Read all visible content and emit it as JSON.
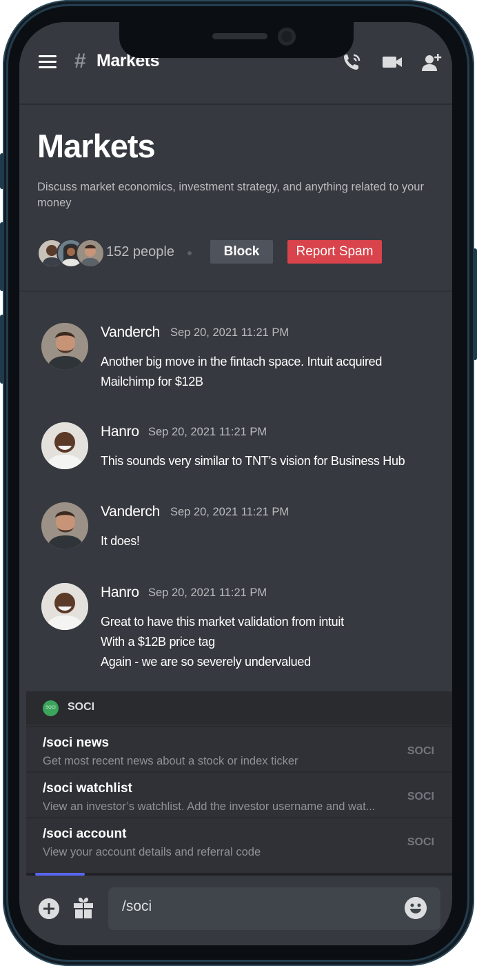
{
  "topbar": {
    "hash": "#",
    "title": "Markets"
  },
  "channel": {
    "title": "Markets",
    "description": "Discuss market economics, investment strategy, and anything related to your money",
    "people": "152 people",
    "block_label": "Block",
    "report_label": "Report Spam"
  },
  "messages": [
    {
      "author": "Vanderch",
      "time": "Sep 20, 2021 11:21 PM",
      "lines": [
        "Another big move in the fintach space. Intuit acquired",
        "Mailchimp for $12B"
      ]
    },
    {
      "author": "Hanro",
      "time": "Sep 20, 2021 11:21 PM",
      "lines": [
        "This sounds very similar to TNT’s vision for Business Hub"
      ]
    },
    {
      "author": "Vanderch",
      "time": "Sep 20, 2021 11:21 PM",
      "lines": [
        "It does!"
      ]
    },
    {
      "author": "Hanro",
      "time": "Sep 20, 2021 11:21 PM",
      "lines": [
        "Great to have this market validation from intuit",
        "With a $12B price tag",
        "Again - we are so severely undervalued"
      ]
    }
  ],
  "popup": {
    "logo_text": "SOCI",
    "title": "SOCI",
    "commands": [
      {
        "name": "/soci news",
        "desc": "Get most recent news about a stock or index ticker",
        "tag": "SOCI"
      },
      {
        "name": "/soci watchlist",
        "desc": "View an investor’s watchlist. Add the investor username and wat...",
        "tag": "SOCI"
      },
      {
        "name": "/soci account",
        "desc": "View your account details and referral code",
        "tag": "SOCI"
      }
    ]
  },
  "composer": {
    "value": "/soci"
  },
  "icons": [
    "hamburger-icon",
    "phone-call-icon",
    "video-icon",
    "add-user-icon",
    "plus-icon",
    "gift-icon",
    "emoji-icon"
  ],
  "colors": {
    "background": "#36393f",
    "popup": "#2f3136",
    "report": "#d9434b",
    "block": "#4f545c",
    "accent": "#5865f2",
    "soci_green": "#3ba55c"
  }
}
